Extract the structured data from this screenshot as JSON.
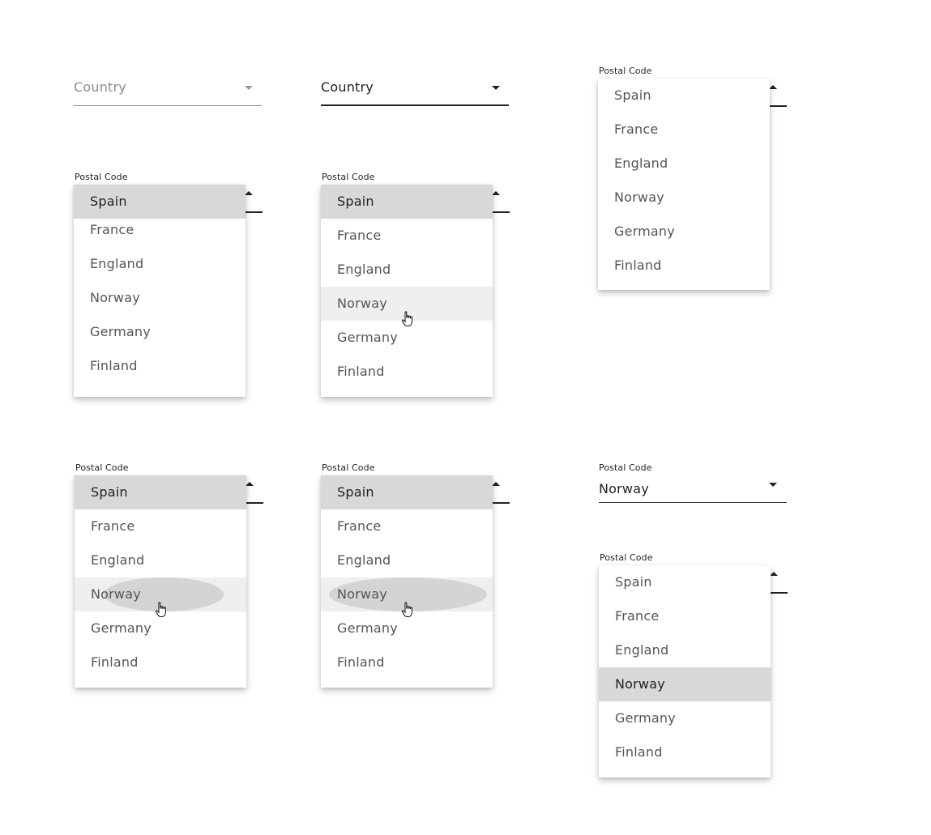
{
  "colors": {
    "selected_bg": "#d8d8d8",
    "hover_bg": "#efefef",
    "ripple": "#d4d4d4",
    "text_dark": "#222222",
    "text_muted": "#555555"
  },
  "fields": {
    "country_label": "Country",
    "postal_label": "Postal Code",
    "selected_value": "Norway"
  },
  "options": [
    "Spain",
    "France",
    "England",
    "Norway",
    "Germany",
    "Finland"
  ],
  "icons": {
    "caret_down": "caret-down-icon",
    "caret_up": "caret-up-icon",
    "cursor": "hand-cursor-icon"
  }
}
